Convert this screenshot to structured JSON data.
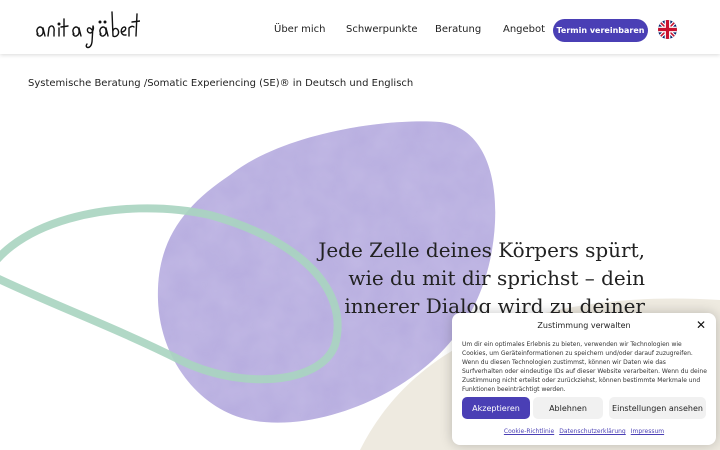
{
  "header": {
    "logo_alt": "anita gäbert",
    "nav": [
      {
        "label": "Über mich"
      },
      {
        "label": "Schwerpunkte"
      },
      {
        "label": "Beratung"
      },
      {
        "label": "Angebot"
      }
    ],
    "cta_label": "Termin vereinbaren",
    "language_flag": "uk-flag-icon"
  },
  "hero": {
    "subtitle": "Systemische Beratung /Somatic Experiencing (SE)® in Deutsch und Englisch",
    "quote_lines": [
      "Jede Zelle deines Körpers spürt,",
      "wie du mit dir sprichst – dein",
      "innerer Dialog wird zu deiner"
    ]
  },
  "consent": {
    "title": "Zustimmung verwalten",
    "text": "Um dir ein optimales Erlebnis zu bieten, verwenden wir Technologien wie Cookies, um Geräteinformationen zu speichern und/oder darauf zuzugreifen. Wenn du diesen Technologien zustimmst, können wir Daten wie das Surfverhalten oder eindeutige IDs auf dieser Website verarbeiten. Wenn du deine Zustimmung nicht erteilst oder zurückziehst, können bestimmte Merkmale und Funktionen beeinträchtigt werden.",
    "accept_label": "Akzeptieren",
    "reject_label": "Ablehnen",
    "settings_label": "Einstellungen ansehen",
    "links": [
      "Cookie-Richtlinie",
      "Datenschutzerklärung",
      "Impressum"
    ]
  },
  "colors": {
    "accent": "#4a3fb5",
    "blob": "#b6acdf",
    "ring": "#a9d4c0",
    "beige": "#eeeae0"
  }
}
